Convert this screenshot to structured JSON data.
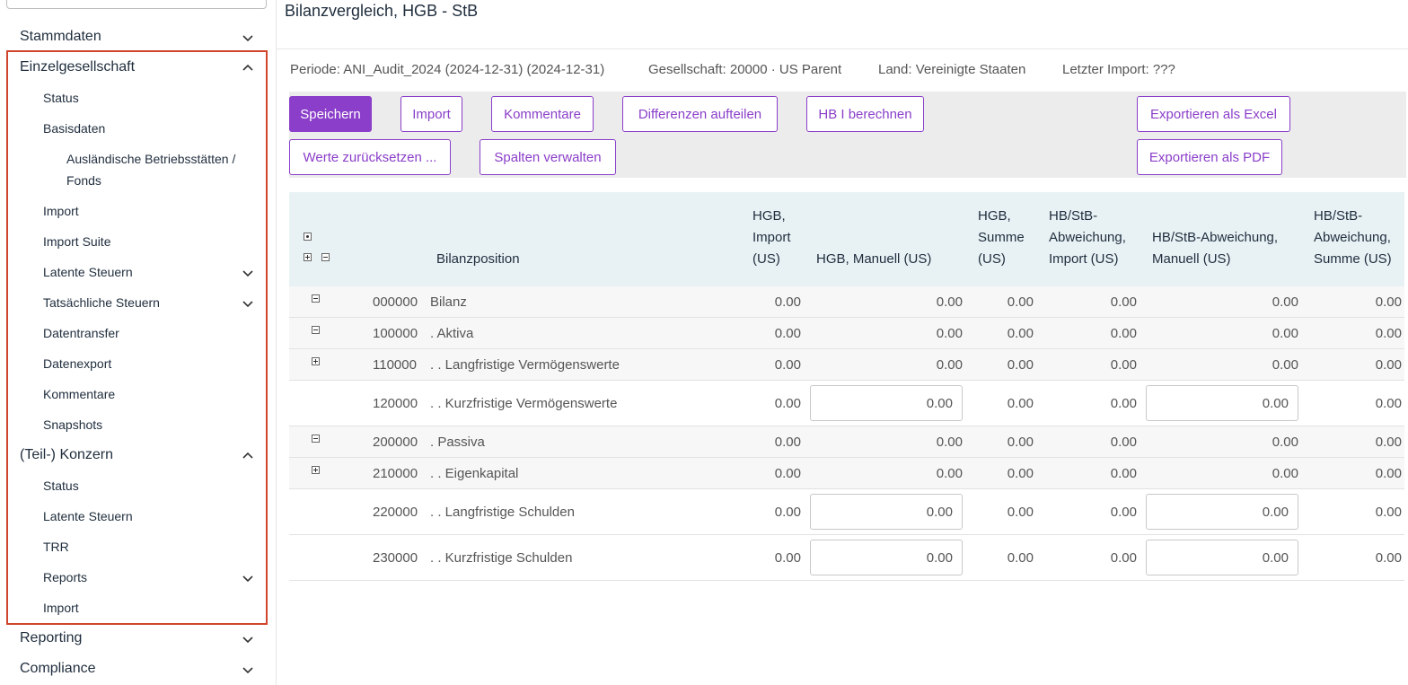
{
  "sidebar": {
    "top_items": [
      {
        "label": "Stammdaten",
        "expanded": false
      },
      {
        "label": "Einzelgesellschaft",
        "expanded": true
      },
      {
        "label": "(Teil-) Konzern",
        "expanded": true
      },
      {
        "label": "Reporting",
        "expanded": false
      },
      {
        "label": "Compliance",
        "expanded": false
      }
    ],
    "einzel_items": [
      {
        "label": "Status"
      },
      {
        "label": "Basisdaten"
      },
      {
        "label": "Ausländische Betriebsstätten / Fonds"
      },
      {
        "label": "Import"
      },
      {
        "label": "Import Suite"
      },
      {
        "label": "Latente Steuern",
        "has_children": true
      },
      {
        "label": "Tatsächliche Steuern",
        "has_children": true
      },
      {
        "label": "Datentransfer"
      },
      {
        "label": "Datenexport"
      },
      {
        "label": "Kommentare"
      },
      {
        "label": "Snapshots"
      }
    ],
    "konzern_items": [
      {
        "label": "Status"
      },
      {
        "label": "Latente Steuern"
      },
      {
        "label": "TRR"
      },
      {
        "label": "Reports",
        "has_children": true
      },
      {
        "label": "Import"
      }
    ]
  },
  "page": {
    "title": "Bilanzvergleich, HGB - StB",
    "periode": "Periode: ANI_Audit_2024 (2024-12-31) (2024-12-31)",
    "gesellschaft": "Gesellschaft: 20000 · US Parent",
    "land": "Land: Vereinigte Staaten",
    "letzter_import": "Letzter Import: ???"
  },
  "toolbar": {
    "speichern": "Speichern",
    "import": "Import",
    "kommentare": "Kommentare",
    "differenzen": "Differenzen aufteilen",
    "hb_berechnen": "HB I berechnen",
    "export_excel": "Exportieren als Excel",
    "werte_zuruecksetzen": "Werte zurücksetzen ...",
    "spalten_verwalten": "Spalten verwalten",
    "export_pdf": "Exportieren als PDF"
  },
  "table": {
    "headers": {
      "bilanzposition": "Bilanzposition",
      "hgb_import": "HGB,\nImport\n(US)",
      "hgb_manuell": "HGB, Manuell (US)",
      "hgb_summe": "HGB,\nSumme\n(US)",
      "hbstb_import": "HB/StB-\nAbweichung,\nImport (US)",
      "hbstb_manuell": "HB/StB-Abweichung,\nManuell (US)",
      "hbstb_summe": "HB/StB-\nAbweichung,\nSumme (US)"
    },
    "rows": [
      {
        "code": "000000",
        "name": "Bilanz",
        "toggle": "minus",
        "editable": false,
        "hgb_import": "0.00",
        "hgb_manuell": "0.00",
        "hgb_summe": "0.00",
        "hbstb_import": "0.00",
        "hbstb_manuell": "0.00",
        "hbstb_summe": "0.00"
      },
      {
        "code": "100000",
        "name": ". Aktiva",
        "toggle": "minus",
        "editable": false,
        "hgb_import": "0.00",
        "hgb_manuell": "0.00",
        "hgb_summe": "0.00",
        "hbstb_import": "0.00",
        "hbstb_manuell": "0.00",
        "hbstb_summe": "0.00"
      },
      {
        "code": "110000",
        "name": ". . Langfristige Vermögenswerte",
        "toggle": "plus",
        "editable": false,
        "hgb_import": "0.00",
        "hgb_manuell": "0.00",
        "hgb_summe": "0.00",
        "hbstb_import": "0.00",
        "hbstb_manuell": "0.00",
        "hbstb_summe": "0.00"
      },
      {
        "code": "120000",
        "name": ". . Kurzfristige Vermögenswerte",
        "toggle": "none",
        "editable": true,
        "hgb_import": "0.00",
        "hgb_manuell": "0.00",
        "hgb_summe": "0.00",
        "hbstb_import": "0.00",
        "hbstb_manuell": "0.00",
        "hbstb_summe": "0.00"
      },
      {
        "code": "200000",
        "name": ". Passiva",
        "toggle": "minus",
        "editable": false,
        "hgb_import": "0.00",
        "hgb_manuell": "0.00",
        "hgb_summe": "0.00",
        "hbstb_import": "0.00",
        "hbstb_manuell": "0.00",
        "hbstb_summe": "0.00"
      },
      {
        "code": "210000",
        "name": ". . Eigenkapital",
        "toggle": "plus",
        "editable": false,
        "hgb_import": "0.00",
        "hgb_manuell": "0.00",
        "hgb_summe": "0.00",
        "hbstb_import": "0.00",
        "hbstb_manuell": "0.00",
        "hbstb_summe": "0.00"
      },
      {
        "code": "220000",
        "name": ". . Langfristige Schulden",
        "toggle": "none",
        "editable": true,
        "hgb_import": "0.00",
        "hgb_manuell": "0.00",
        "hgb_summe": "0.00",
        "hbstb_import": "0.00",
        "hbstb_manuell": "0.00",
        "hbstb_summe": "0.00"
      },
      {
        "code": "230000",
        "name": ". . Kurzfristige Schulden",
        "toggle": "none",
        "editable": true,
        "hgb_import": "0.00",
        "hgb_manuell": "0.00",
        "hgb_summe": "0.00",
        "hbstb_import": "0.00",
        "hbstb_manuell": "0.00",
        "hbstb_summe": "0.00"
      }
    ]
  },
  "colors": {
    "accent": "#8a3ec9",
    "highlight": "#d0452c",
    "header_bg": "#e8f2f5"
  }
}
